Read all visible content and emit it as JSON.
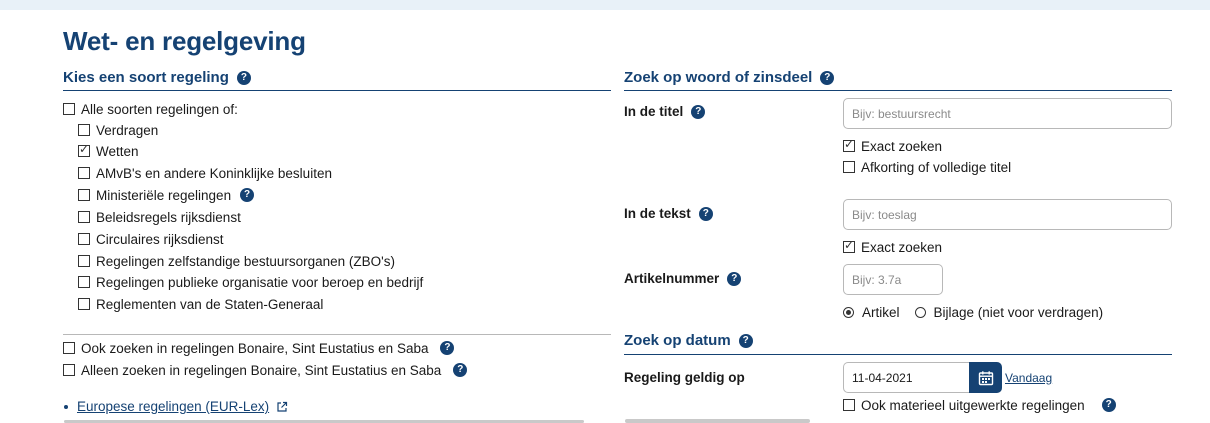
{
  "page_title": "Wet- en regelgeving",
  "help_glyph": "?",
  "left": {
    "section_title": "Kies een soort regeling",
    "all_types": {
      "label": "Alle soorten regelingen of:",
      "checked": false
    },
    "types": [
      {
        "label": "Verdragen",
        "checked": false,
        "help": false
      },
      {
        "label": "Wetten",
        "checked": true,
        "help": false
      },
      {
        "label": "AMvB's en andere Koninklijke besluiten",
        "checked": false,
        "help": false
      },
      {
        "label": "Ministeriële regelingen",
        "checked": false,
        "help": true
      },
      {
        "label": "Beleidsregels rijksdienst",
        "checked": false,
        "help": false
      },
      {
        "label": "Circulaires rijksdienst",
        "checked": false,
        "help": false
      },
      {
        "label": "Regelingen zelfstandige bestuursorganen (ZBO's)",
        "checked": false,
        "help": false
      },
      {
        "label": "Regelingen publieke organisatie voor beroep en bedrijf",
        "checked": false,
        "help": false
      },
      {
        "label": "Reglementen van de Staten-Generaal",
        "checked": false,
        "help": false
      }
    ],
    "extra_options": [
      {
        "label": "Ook zoeken in regelingen Bonaire, Sint Eustatius en Saba",
        "checked": false
      },
      {
        "label": "Alleen zoeken in regelingen Bonaire, Sint Eustatius en Saba",
        "checked": false
      }
    ],
    "eurlex_link": "Europese regelingen (EUR-Lex)"
  },
  "right": {
    "word_section_title": "Zoek op woord of zinsdeel",
    "title_field": {
      "label": "In de titel",
      "placeholder": "Bijv: bestuursrecht",
      "value": ""
    },
    "title_exact": {
      "label": "Exact zoeken",
      "checked": true
    },
    "title_abbrev": {
      "label": "Afkorting of volledige titel",
      "checked": false
    },
    "text_field": {
      "label": "In de tekst",
      "placeholder": "Bijv: toeslag",
      "value": ""
    },
    "text_exact": {
      "label": "Exact zoeken",
      "checked": true
    },
    "article_field": {
      "label": "Artikelnummer",
      "placeholder": "Bijv: 3.7a",
      "value": ""
    },
    "radio_article": {
      "label": "Artikel",
      "checked": true
    },
    "radio_annex": {
      "label": "Bijlage (niet voor verdragen)",
      "checked": false
    },
    "date_section_title": "Zoek op datum",
    "valid_on": {
      "label": "Regeling geldig op",
      "value": "11-04-2021",
      "today_link": "Vandaag"
    },
    "material": {
      "label": "Ook materieel uitgewerkte regelingen",
      "checked": false
    }
  },
  "colors": {
    "brand": "#154273",
    "band": "#e8f1f8",
    "border": "#b8b8b8"
  }
}
